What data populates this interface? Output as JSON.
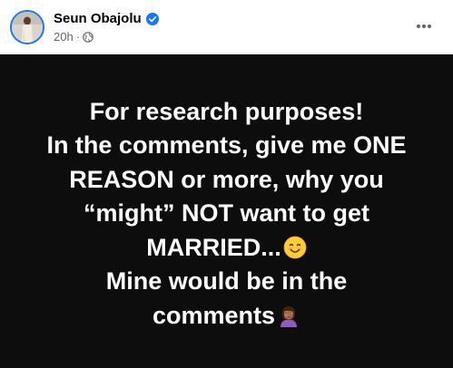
{
  "post": {
    "author": {
      "name": "Seun Obajolu",
      "verified": true
    },
    "timestamp": "20h",
    "separator": "·",
    "audience_icon": "globe-icon",
    "more_icon": "more-options-icon",
    "body": {
      "background": "#0d0d0d",
      "text_color": "#ffffff",
      "lines": [
        "For research purposes!",
        "In the comments, give me ONE",
        "REASON or more, why you",
        "“might” NOT want to get",
        "MARRIED...",
        "Mine would be in the",
        "comments"
      ],
      "emojis": {
        "line5": "smiling-face-emoji",
        "line7": "woman-facepalming-emoji"
      }
    }
  },
  "colors": {
    "name": "#050505",
    "meta": "#65676b",
    "verified": "#1877f2"
  }
}
